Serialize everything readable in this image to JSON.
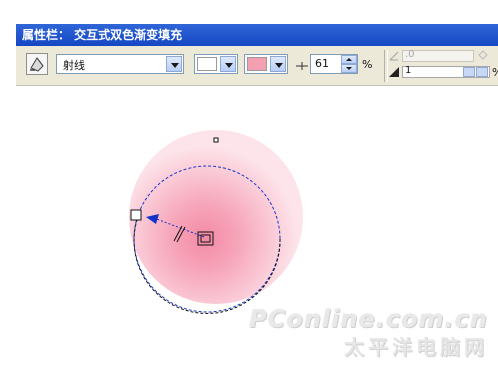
{
  "property_bar": {
    "title": "属性栏： 交互式双色渐变填充"
  },
  "toolbar": {
    "fill_type_icon": "interactive-fill-icon",
    "fill_type": "射线",
    "color_from": {
      "value": "#ffffff"
    },
    "color_to": {
      "value": "#f59fb2"
    },
    "midpoint": {
      "value": "61",
      "unit": "%"
    },
    "angle_field": {
      "value": ".0"
    },
    "edge_pad": {
      "value": "1",
      "unit": "%"
    }
  },
  "canvas": {
    "gradient_colors": {
      "center": "#f48aa6",
      "edge": "#fde4ea"
    },
    "handle_color": "#1432c8"
  },
  "watermark": {
    "line1": "PConline.com.cn",
    "line2": "太平洋电脑网"
  }
}
